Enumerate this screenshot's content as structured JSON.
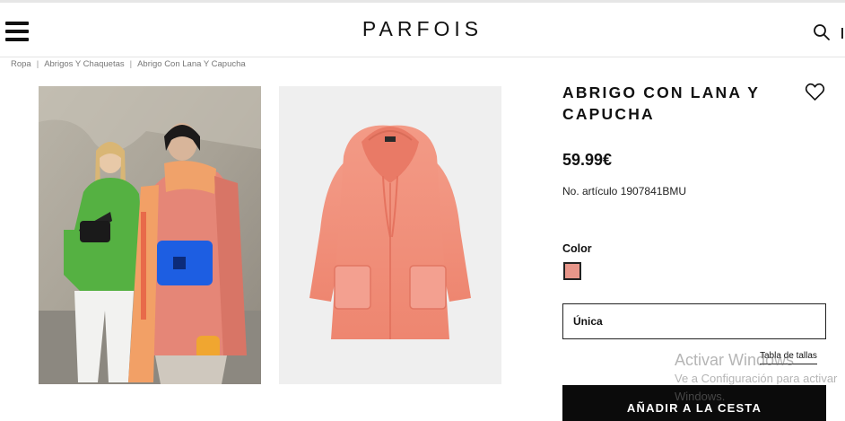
{
  "header": {
    "logo": "PARFOIS"
  },
  "breadcrumb": {
    "items": [
      "Ropa",
      "Abrigos Y Chaquetas",
      "Abrigo Con Lana Y Capucha"
    ],
    "separator": "|"
  },
  "product": {
    "title": "ABRIGO CON LANA Y CAPUCHA",
    "price": "59.99€",
    "reference": "No. artículo 1907841BMU",
    "color_label": "Color",
    "color_swatch": "#e8968a",
    "size_value": "Única",
    "size_guide": "Tabla de tallas",
    "add_to_cart": "AÑADIR A LA CESTA"
  },
  "icons": {
    "menu": "hamburger-menu-icon",
    "search": "search-icon",
    "favorite": "heart-icon"
  },
  "watermark": {
    "title": "Activar Windows",
    "line1": "Ve a Configuración para activar",
    "line2": "Windows."
  },
  "colors": {
    "coat": "#f08a78",
    "button": "#0b0b0b"
  }
}
